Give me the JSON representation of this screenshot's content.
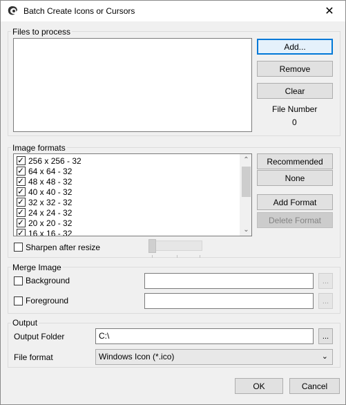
{
  "window": {
    "title": "Batch Create Icons or Cursors",
    "close_label": "✕"
  },
  "files": {
    "group_label": "Files to process",
    "add_label": "Add...",
    "remove_label": "Remove",
    "clear_label": "Clear",
    "file_number_label": "File Number",
    "file_number_value": "0"
  },
  "formats": {
    "group_label": "Image formats",
    "items": [
      {
        "label": "256 x 256 - 32",
        "checked": true
      },
      {
        "label": "64 x 64 - 32",
        "checked": true
      },
      {
        "label": "48 x 48 - 32",
        "checked": true
      },
      {
        "label": "40 x 40 - 32",
        "checked": true
      },
      {
        "label": "32 x 32 - 32",
        "checked": true
      },
      {
        "label": "24 x 24 - 32",
        "checked": true
      },
      {
        "label": "20 x 20 - 32",
        "checked": true
      },
      {
        "label": "16 x 16 - 32",
        "checked": true
      }
    ],
    "recommended_label": "Recommended",
    "none_label": "None",
    "add_format_label": "Add Format",
    "delete_format_label": "Delete Format",
    "sharpen_label": "Sharpen after resize",
    "sharpen_checked": false
  },
  "merge": {
    "group_label": "Merge Image",
    "background_label": "Background",
    "background_value": "",
    "foreground_label": "Foreground",
    "foreground_value": "",
    "browse_label": "..."
  },
  "output": {
    "group_label": "Output",
    "folder_label": "Output Folder",
    "folder_value": "C:\\",
    "browse_label": "...",
    "format_label": "File format",
    "format_value": "Windows Icon (*.ico)"
  },
  "footer": {
    "ok_label": "OK",
    "cancel_label": "Cancel"
  }
}
